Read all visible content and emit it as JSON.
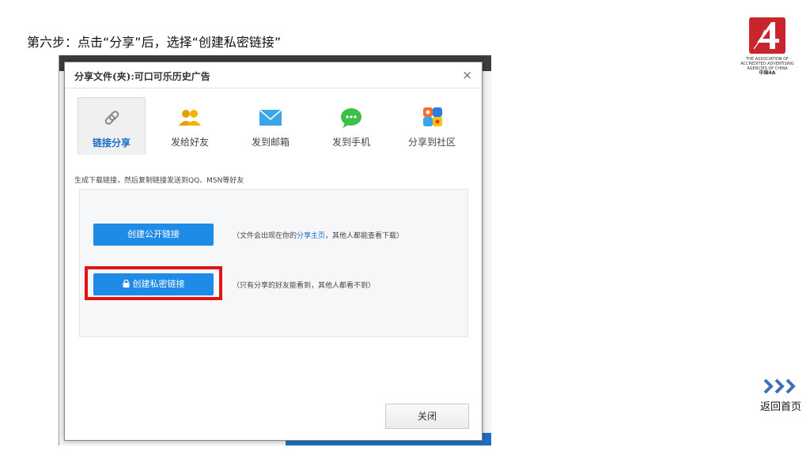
{
  "step_title": "第六步：点击“分享”后，选择“创建私密链接”",
  "dialog": {
    "title": "分享文件(夹):可口可乐历史广告",
    "close_symbol": "×",
    "tabs": [
      {
        "label": "链接分享",
        "icon": "link-icon",
        "active": true
      },
      {
        "label": "发给好友",
        "icon": "friends-icon",
        "active": false
      },
      {
        "label": "发到邮箱",
        "icon": "mail-icon",
        "active": false
      },
      {
        "label": "发到手机",
        "icon": "chat-icon",
        "active": false
      },
      {
        "label": "分享到社区",
        "icon": "community-icon",
        "active": false
      }
    ],
    "hint": "生成下载链接，然后复制链接发送到QQ、MSN等好友",
    "public_button": "创建公开链接",
    "public_note_prefix": "（文件会出现在你的",
    "public_note_link": "分享主页",
    "public_note_suffix": "，其他人都能查看下载）",
    "private_button": "创建私密链接",
    "private_note": "（只有分享的好友能看到，其他人都看不到）",
    "close_button": "关闭"
  },
  "logo": {
    "en_lines": [
      "THE ASSOCIATION OF",
      "ACCREDITED ADVERTISING",
      "AGENCIES OF CHINA"
    ],
    "cn": "中国4A"
  },
  "home_nav": {
    "label": "返回首页",
    "icon": "triple-chevron-right-icon"
  },
  "colors": {
    "accent": "#1e8be6",
    "highlight": "#e01414",
    "logo_red": "#c8262c"
  }
}
